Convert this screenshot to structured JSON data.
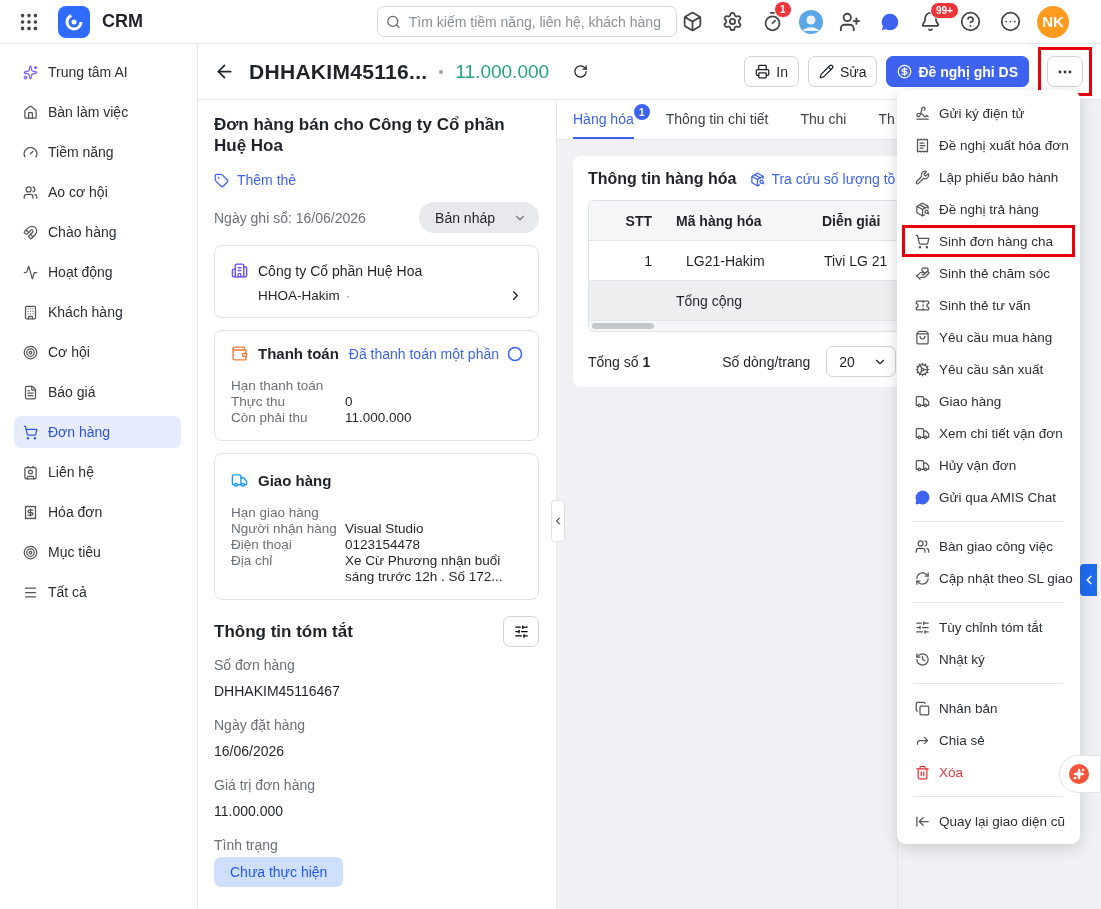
{
  "app": {
    "name": "CRM"
  },
  "search": {
    "placeholder": "Tìm kiếm tiềm năng, liên hệ, khách hàng"
  },
  "topbar": {
    "timer_badge": "1",
    "bell_badge": "99+",
    "avatar_initials": "NK"
  },
  "sidebar": {
    "items": [
      {
        "label": "Trung tâm AI",
        "selected": false
      },
      {
        "label": "Bàn làm việc",
        "selected": false
      },
      {
        "label": "Tiềm năng",
        "selected": false
      },
      {
        "label": "Ao cơ hội",
        "selected": false
      },
      {
        "label": "Chào hàng",
        "selected": false
      },
      {
        "label": "Hoạt động",
        "selected": false
      },
      {
        "label": "Khách hàng",
        "selected": false
      },
      {
        "label": "Cơ hội",
        "selected": false
      },
      {
        "label": "Báo giá",
        "selected": false
      },
      {
        "label": "Đơn hàng",
        "selected": true
      },
      {
        "label": "Liên hệ",
        "selected": false
      },
      {
        "label": "Hóa đơn",
        "selected": false
      },
      {
        "label": "Mục tiêu",
        "selected": false
      },
      {
        "label": "Tất cả",
        "selected": false
      }
    ]
  },
  "header": {
    "title": "DHHAKIM45116...",
    "amount": "11.000.000",
    "more_highlighted": true,
    "buttons": [
      {
        "label": "In",
        "kind": "outline"
      },
      {
        "label": "Sửa",
        "kind": "outline"
      },
      {
        "label": "Đề nghị ghi DS",
        "kind": "primary"
      }
    ]
  },
  "summary_panel": {
    "title": "Đơn hàng bán cho Công ty Cổ phần Huệ Hoa",
    "add_tag": "Thêm thẻ",
    "record_date": "Ngày ghi sổ: 16/06/2026",
    "status": "Bản nháp",
    "customer": {
      "name": "Công ty Cổ phần Huệ Hoa",
      "code": "HHOA-Hakim",
      "separator": "·"
    },
    "payment": {
      "title": "Thanh toán",
      "status": "Đã thanh toán một phần",
      "rows": [
        {
          "label": "Hạn thanh toán"
        },
        {
          "label": "Thực thu",
          "value": "0"
        },
        {
          "label": "Còn phải thu",
          "value": "11.000.000"
        }
      ]
    },
    "delivery": {
      "title": "Giao hàng",
      "rows": [
        {
          "label": "Hạn giao hàng"
        },
        {
          "label": "Người nhận hàng",
          "value": "Visual Studio"
        },
        {
          "label": "Điện thoại",
          "value": "0123154478"
        },
        {
          "label": "Địa chỉ",
          "value": "Xe Cừ Phương nhận buổi sáng trước 12h . Số 172..."
        }
      ]
    },
    "summary": {
      "title": "Thông tin tóm tắt",
      "fields": [
        {
          "label": "Số đơn hàng",
          "value": "DHHAKIM45116467"
        },
        {
          "label": "Ngày đặt hàng",
          "value": "16/06/2026"
        },
        {
          "label": "Giá trị đơn hàng",
          "value": "11.000.000"
        }
      ],
      "status_label": "Tình trạng",
      "status": "Chưa thực hiện"
    }
  },
  "tabs": [
    {
      "label": "Hàng hóa",
      "selected": true,
      "badge": "1"
    },
    {
      "label": "Thông tin chi tiết",
      "selected": false
    },
    {
      "label": "Thu chi",
      "selected": false
    },
    {
      "label": "Th",
      "selected": false
    }
  ],
  "goods": {
    "title": "Thông tin hàng hóa",
    "lookup_link": "Tra cứu số lượng tồ",
    "columns": [
      "STT",
      "Mã hàng hóa",
      "Diễn giải"
    ],
    "rows": [
      [
        "1",
        "LG21-Hakim",
        "Tivi LG 21"
      ]
    ],
    "total_label": "Tổng cộng",
    "total_count": "Tổng số **1**",
    "page_size_label": "Số dòng/trang",
    "page_size": "20"
  },
  "menu": {
    "groups": [
      [
        {
          "label": "Gửi ký điện tử",
          "highlighted": false,
          "danger": false
        },
        {
          "label": "Đề nghị xuất hóa đơn",
          "highlighted": false,
          "danger": false
        },
        {
          "label": "Lập phiếu bảo hành",
          "highlighted": false,
          "danger": false
        },
        {
          "label": "Đề nghị trả hàng",
          "highlighted": false,
          "danger": false
        },
        {
          "label": "Sinh đơn hàng cha",
          "highlighted": true,
          "danger": false
        },
        {
          "label": "Sinh thẻ chăm sóc",
          "highlighted": false,
          "danger": false
        },
        {
          "label": "Sinh thẻ tư vấn",
          "highlighted": false,
          "danger": false
        },
        {
          "label": "Yêu cầu mua hàng",
          "highlighted": false,
          "danger": false
        },
        {
          "label": "Yêu cầu sản xuất",
          "highlighted": false,
          "danger": false
        },
        {
          "label": "Giao hàng",
          "highlighted": false,
          "danger": false
        },
        {
          "label": "Xem chi tiết vận đơn",
          "highlighted": false,
          "danger": false
        },
        {
          "label": "Hủy vận đơn",
          "highlighted": false,
          "danger": false
        },
        {
          "label": "Gửi qua AMIS Chat",
          "highlighted": false,
          "danger": false
        }
      ],
      [
        {
          "label": "Bàn giao công việc",
          "highlighted": false,
          "danger": false
        },
        {
          "label": "Cập nhật theo SL giao",
          "highlighted": false,
          "danger": false
        }
      ],
      [
        {
          "label": "Tùy chỉnh tóm tắt",
          "highlighted": false,
          "danger": false
        },
        {
          "label": "Nhật ký",
          "highlighted": false,
          "danger": false
        }
      ],
      [
        {
          "label": "Nhân bản",
          "highlighted": false,
          "danger": false
        },
        {
          "label": "Chia sẻ",
          "highlighted": false,
          "danger": false
        },
        {
          "label": "Xóa",
          "highlighted": false,
          "danger": true
        }
      ],
      [
        {
          "label": "Quay lại giao diện cũ",
          "highlighted": false,
          "danger": false
        }
      ]
    ]
  }
}
